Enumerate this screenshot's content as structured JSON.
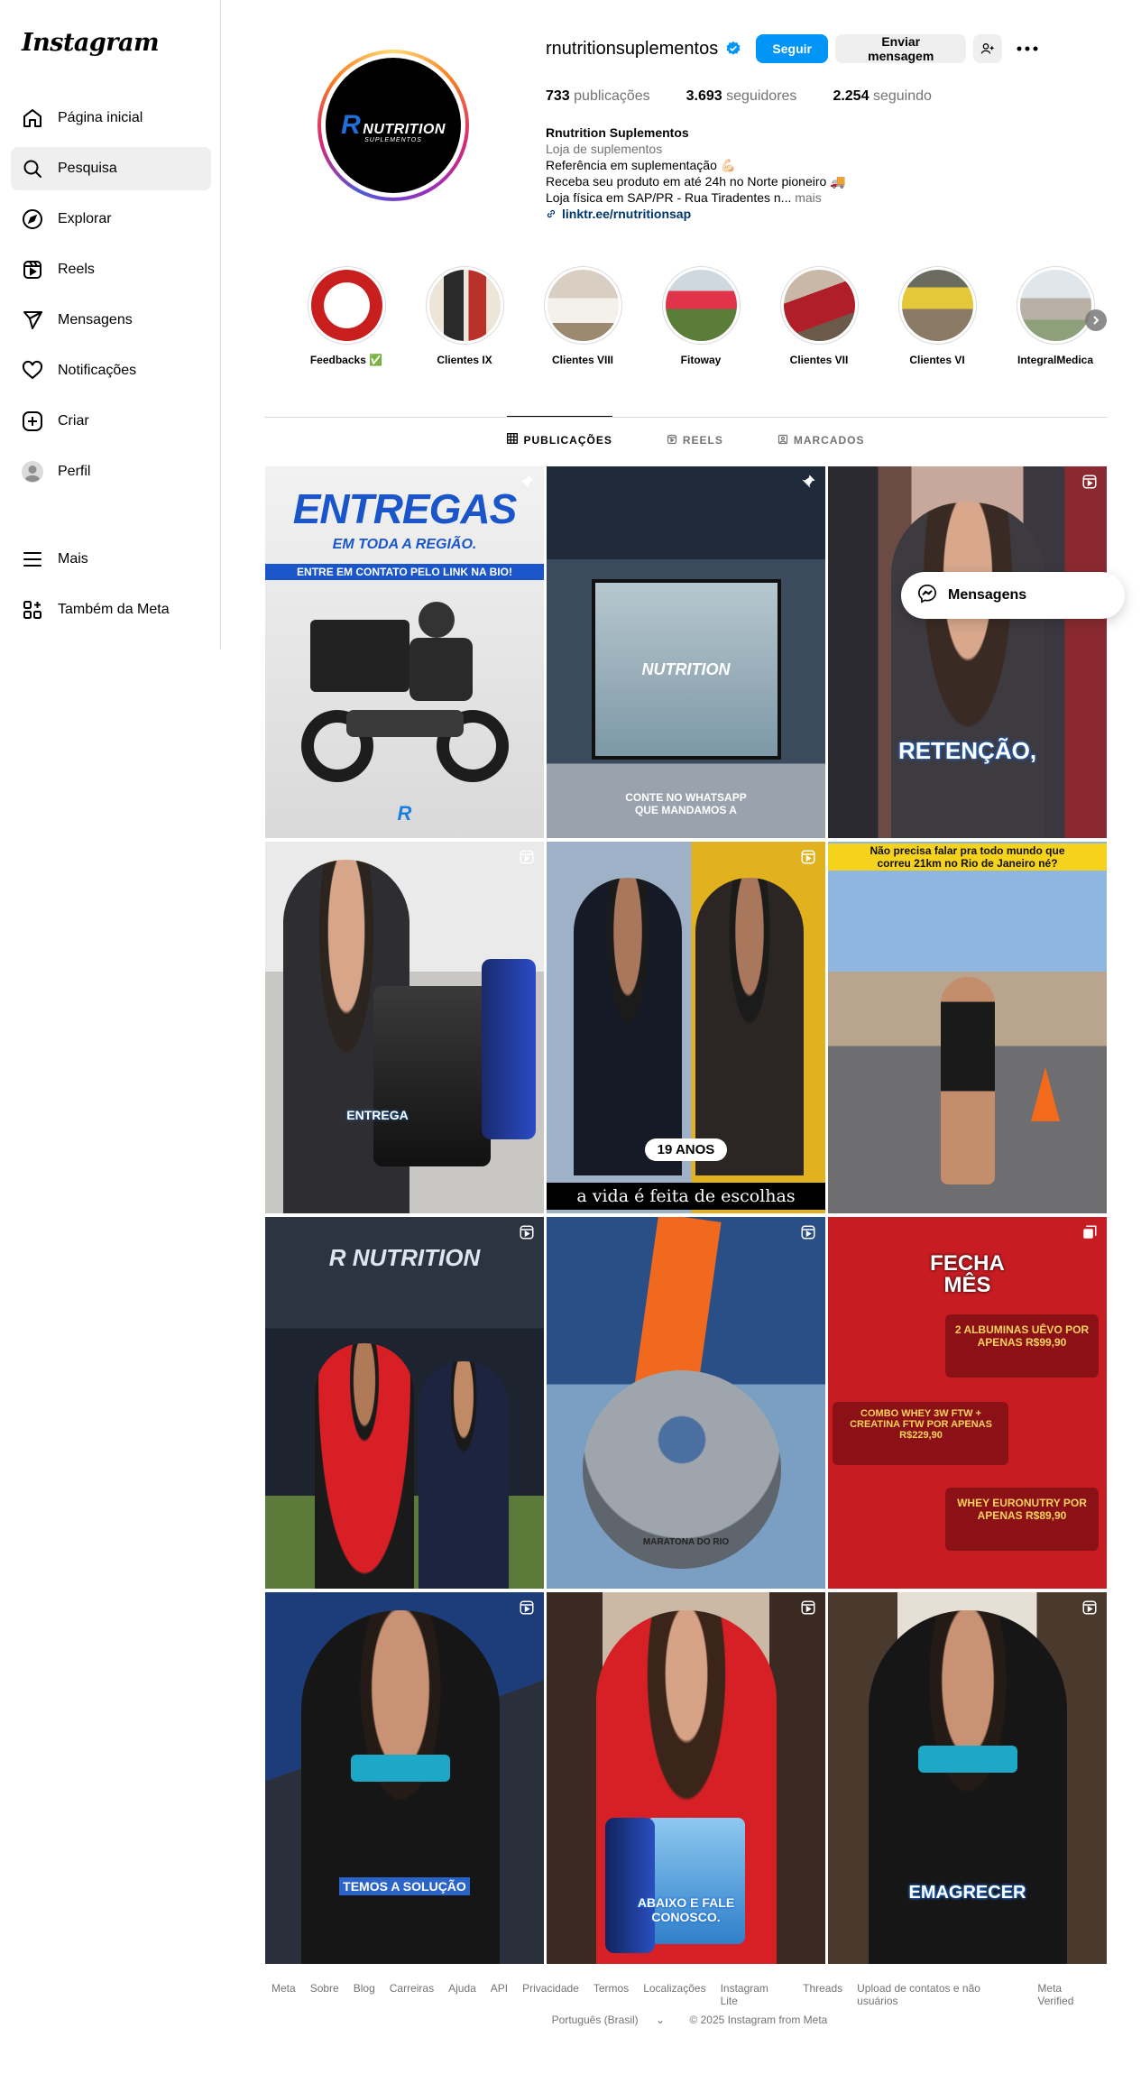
{
  "sidebar": {
    "logo": "Instagram",
    "items": [
      {
        "label": "Página inicial",
        "icon": "home-icon"
      },
      {
        "label": "Pesquisa",
        "icon": "search-icon"
      },
      {
        "label": "Explorar",
        "icon": "compass-icon"
      },
      {
        "label": "Reels",
        "icon": "reels-icon"
      },
      {
        "label": "Mensagens",
        "icon": "send-icon"
      },
      {
        "label": "Notificações",
        "icon": "heart-icon"
      },
      {
        "label": "Criar",
        "icon": "plus-icon"
      },
      {
        "label": "Perfil",
        "icon": "avatar-icon"
      }
    ],
    "bottom": [
      {
        "label": "Mais",
        "icon": "menu-icon"
      },
      {
        "label": "Também da Meta",
        "icon": "meta-icon"
      }
    ]
  },
  "profile": {
    "username": "rnutritionsuplementos",
    "follow_label": "Seguir",
    "message_label": "Enviar mensagem",
    "stats": {
      "posts_num": "733",
      "posts_label": "publicações",
      "followers_num": "3.693",
      "followers_label": "seguidores",
      "following_num": "2.254",
      "following_label": "seguindo"
    },
    "bio": {
      "name": "Rnutrition Suplementos",
      "category": "Loja de suplementos",
      "line1": "Referência em suplementação 💪🏻",
      "line2": "Receba seu produto em até 24h no Norte pioneiro 🚚",
      "line3": "Loja física em SAP/PR - Rua Tiradentes n...",
      "more": "mais",
      "link": "linktr.ee/rnutritionsap"
    },
    "avatar_brand": "NUTRITION",
    "avatar_r": "R",
    "avatar_sub": "SUPLEMENTOS"
  },
  "highlights": [
    {
      "label": "Feedbacks ✅"
    },
    {
      "label": "Clientes IX"
    },
    {
      "label": "Clientes VIII"
    },
    {
      "label": "Fitoway"
    },
    {
      "label": "Clientes VII"
    },
    {
      "label": "Clientes VI"
    },
    {
      "label": "IntegralMedica"
    }
  ],
  "tabs": [
    {
      "label": "PUBLICAÇÕES"
    },
    {
      "label": "REELS"
    },
    {
      "label": "MARCADOS"
    }
  ],
  "posts": {
    "p1_title": "ENTREGAS",
    "p1_sub": "EM TODA A REGIÃO.",
    "p1_bar": "ENTRE EM CONTATO PELO LINK NA BIO!",
    "p2_text": "CONTE NO WHATSAPP QUE MANDAMOS A",
    "p2_sign": "NUTRITION",
    "p3_text": "RETENÇÃO,",
    "p4_text": "ENTREGA",
    "p5_badge": "19 ANOS",
    "p5_text": "a vida é feita de escolhas",
    "p6_text": "Não precisa falar pra todo mundo que correu 21km no Rio de Janeiro né?",
    "p8_text": "MARATONA DO RIO",
    "p9_title": "FECHA MÊS",
    "p9_offer1": "2 ALBUMINAS UÊVO POR APENAS R$99,90",
    "p9_offer2": "COMBO WHEY 3W FTW + CREATINA FTW POR APENAS R$229,90",
    "p9_offer3": "WHEY EURONUTRY POR APENAS R$89,90",
    "p10_text": "TEMOS A SOLUÇÃO",
    "p11_text": "ABAIXO E FALE CONOSCO.",
    "p12_text": "EMAGRECER"
  },
  "floating": {
    "label": "Mensagens"
  },
  "footer": {
    "links": [
      "Meta",
      "Sobre",
      "Blog",
      "Carreiras",
      "Ajuda",
      "API",
      "Privacidade",
      "Termos",
      "Localizações",
      "Instagram Lite",
      "Threads",
      "Upload de contatos e não usuários",
      "Meta Verified"
    ],
    "language": "Português (Brasil)",
    "copyright": "© 2025 Instagram from Meta"
  }
}
